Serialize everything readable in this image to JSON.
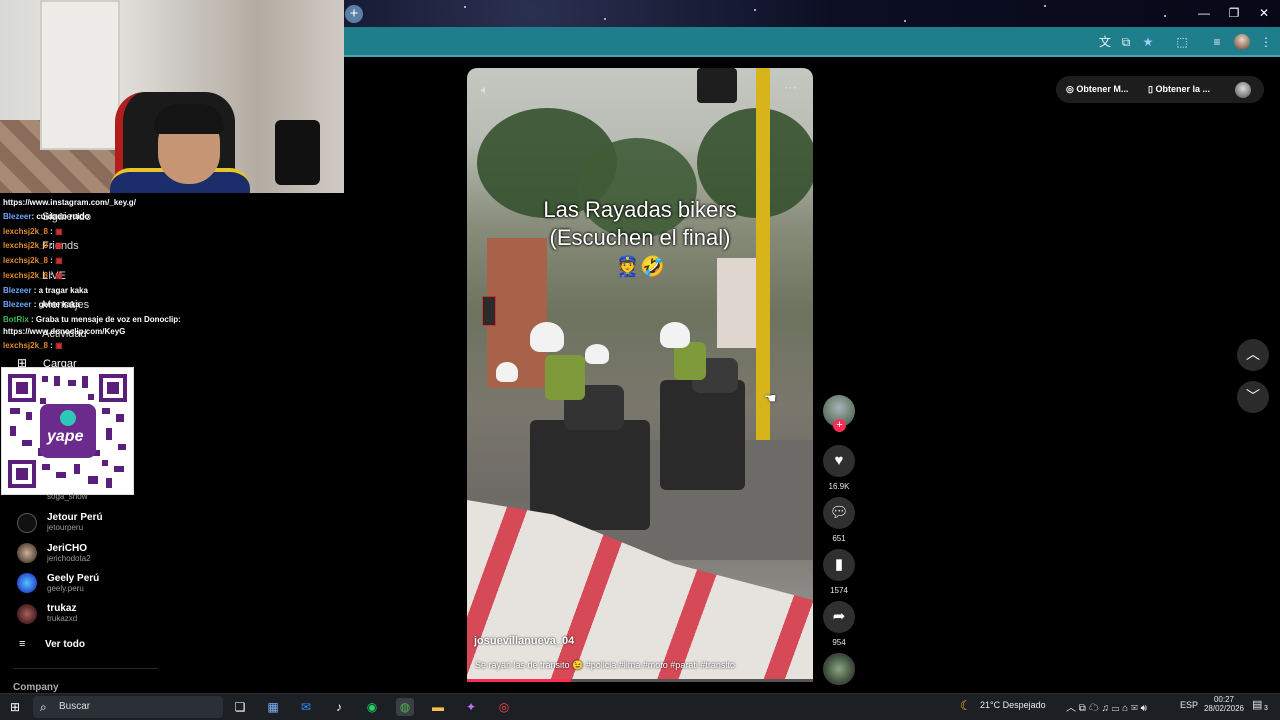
{
  "browser": {
    "new_tab_icon": "+",
    "window_controls": [
      "—",
      "❐",
      "✕"
    ],
    "addressbar_icons": [
      "translate-icon",
      "cast-icon",
      "star-icon",
      "extensions-icon",
      "media-icon",
      "profile-icon",
      "menu-icon"
    ]
  },
  "chat": {
    "lines": [
      {
        "user": "",
        "text": "https://www.instagram.com/_key.g/"
      },
      {
        "user": "Blezeer",
        "text": ": cuidado ruido"
      },
      {
        "user": "lexchsj2k_8",
        "text": ":"
      },
      {
        "user": "lexchsj2k_8",
        "text": ":"
      },
      {
        "user": "lexchsj2k_8",
        "text": ":"
      },
      {
        "user": "lexchsj2k_8",
        "text": ":"
      },
      {
        "user": "Blezeer",
        "text": ": a tragar kaka"
      },
      {
        "user": "Blezeer",
        "text": ": gente kaka"
      },
      {
        "user": "BotRix",
        "text": ": Graba tu mensaje de voz en Donoclip:"
      },
      {
        "user": "",
        "text": "https://www.donoclip.com/KeyG"
      },
      {
        "user": "lexchsj2k_8",
        "text": ":"
      }
    ]
  },
  "sidebar": {
    "items": [
      {
        "label": "Siguiendo"
      },
      {
        "label": "Friends"
      },
      {
        "label": "LIVE"
      },
      {
        "label": "Mensajes"
      },
      {
        "label": "Actividad"
      },
      {
        "label": "Cargar"
      }
    ],
    "accounts": [
      {
        "name": "",
        "user": "soga_show"
      },
      {
        "name": "Jetour Perú",
        "user": "jetourperu"
      },
      {
        "name": "JeriCHO",
        "user": "jerichodota2"
      },
      {
        "name": "Geely Perú",
        "user": "geely.peru"
      },
      {
        "name": "trukaz",
        "user": "trukazxd"
      }
    ],
    "see_all": "Ver todo",
    "company": "Company",
    "qr_label": "yape"
  },
  "video": {
    "title_line1": "Las Rayadas bikers",
    "title_line2": "(Escuchen el final)",
    "emojis": "👮🤣",
    "username": "josuevillanueva_04",
    "caption": "Se rayan las de tránsito 😉 #policia #lima #moto #parati #transito",
    "progress": 0.3
  },
  "actions": {
    "likes": "16.9K",
    "comments": "651",
    "saves": "1574",
    "shares": "954"
  },
  "top_right": {
    "pill1": "Obtener M...",
    "pill2": "Obtener la ..."
  },
  "taskbar": {
    "search_placeholder": "Buscar",
    "weather": "21°C  Despejado",
    "lang": "ESP",
    "time": "00:27",
    "date": "28/02/2026",
    "notifications": "3"
  },
  "colors": {
    "accent": "#fe2c55",
    "addressbar": "#1f7e8c",
    "taskbar": "#1c1f24"
  }
}
